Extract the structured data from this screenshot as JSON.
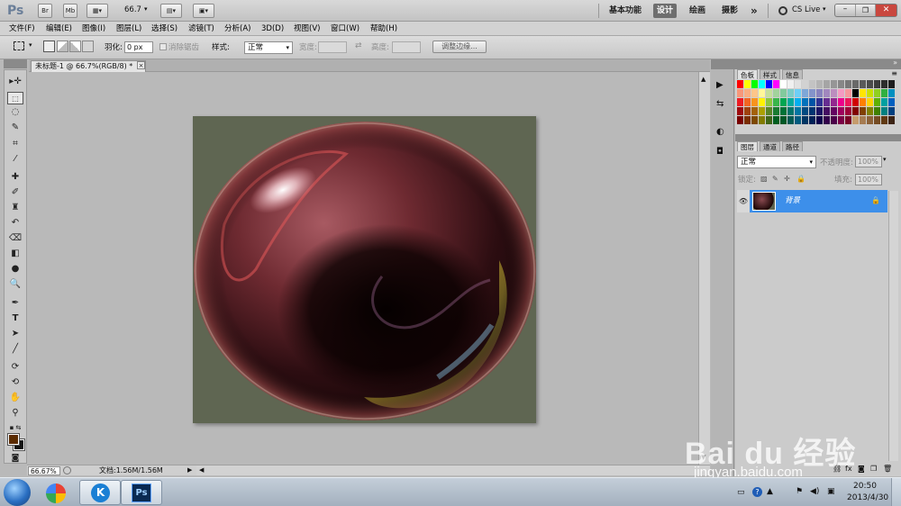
{
  "appbar": {
    "logo": "Ps",
    "br": "Br",
    "mb": "Mb",
    "zoom": "66.7",
    "workspaces": [
      "基本功能",
      "设计",
      "绘画",
      "摄影"
    ],
    "active_workspace": "设计",
    "more": "»",
    "cslive": "CS Live"
  },
  "menu": [
    "文件(F)",
    "编辑(E)",
    "图像(I)",
    "图层(L)",
    "选择(S)",
    "滤镜(T)",
    "分析(A)",
    "3D(D)",
    "视图(V)",
    "窗口(W)",
    "帮助(H)"
  ],
  "options": {
    "feather_label": "羽化:",
    "feather_value": "0 px",
    "antialias_label": "消除锯齿",
    "style_label": "样式:",
    "style_value": "正常",
    "width_label": "宽度:",
    "height_label": "高度:",
    "refine_button": "调整边缘..."
  },
  "document": {
    "tab_title": "未标题-1 @ 66.7%(RGB/8) *",
    "tab_close": "×",
    "zoom_field": "66.67%",
    "doc_info": "文档:1.56M/1.56M",
    "canvas_color": "#5f6652"
  },
  "panels": {
    "swatch_tabs": [
      "色板",
      "样式",
      "信息"
    ],
    "layer_tabs": [
      "图层",
      "通道",
      "路径"
    ],
    "blend_mode": "正常",
    "opacity_label": "不透明度:",
    "opacity_value": "100%",
    "lock_label": "锁定:",
    "fill_label": "填充:",
    "fill_value": "100%",
    "layer_name": "背景"
  },
  "swatches": [
    "#ff0000",
    "#ffff00",
    "#00ff00",
    "#00ffff",
    "#0000ff",
    "#ff00ff",
    "#ffffff",
    "#f0f0f0",
    "#e1e1e1",
    "#d2d2d2",
    "#c3c3c3",
    "#b4b4b4",
    "#a5a5a5",
    "#969696",
    "#878787",
    "#787878",
    "#696969",
    "#5a5a5a",
    "#4b4b4b",
    "#3c3c3c",
    "#2d2d2d",
    "#1e1e1e",
    "#f7977a",
    "#f9ad81",
    "#fdc68a",
    "#fff79a",
    "#c4df9b",
    "#a2d39c",
    "#82ca9d",
    "#7bcdc8",
    "#6ecff6",
    "#7ea7d8",
    "#8493ca",
    "#8882be",
    "#a187be",
    "#bc8dbf",
    "#f49ac2",
    "#f6989d",
    "#000000",
    "#ffe600",
    "#c8e000",
    "#90d020",
    "#30b040",
    "#0090c0",
    "#ed1c24",
    "#f26522",
    "#f7941d",
    "#fff200",
    "#8dc63f",
    "#39b54a",
    "#00a651",
    "#00a99d",
    "#00aeef",
    "#0072bc",
    "#0054a6",
    "#2e3192",
    "#662d91",
    "#92278f",
    "#ec008c",
    "#ed145b",
    "#d00000",
    "#ff8000",
    "#ffd200",
    "#60b000",
    "#00a0a0",
    "#0060c0",
    "#9e0b0f",
    "#a0410d",
    "#a3620a",
    "#aba000",
    "#598527",
    "#197b30",
    "#007236",
    "#00746b",
    "#0076a3",
    "#004a80",
    "#003471",
    "#1b1464",
    "#440e62",
    "#630460",
    "#9e005d",
    "#9e0039",
    "#800000",
    "#804000",
    "#808000",
    "#408000",
    "#008080",
    "#004080",
    "#790000",
    "#7b2e00",
    "#7d4900",
    "#827b00",
    "#406618",
    "#005e20",
    "#005826",
    "#005952",
    "#005b7f",
    "#003663",
    "#002157",
    "#0d004c",
    "#32004b",
    "#4b0049",
    "#7b0046",
    "#7a0026",
    "#c69c6d",
    "#a67c52",
    "#8c6239",
    "#754c24",
    "#603913",
    "#3c2415"
  ],
  "datetime": {
    "time": "20:50",
    "date": "2013/4/30"
  },
  "watermark": {
    "brand": "Bai du 经验",
    "url": "jingyan.baidu.com"
  },
  "colors": {
    "fg": "#5a2a00",
    "bg": "#111111",
    "accent": "#3d8fea"
  }
}
